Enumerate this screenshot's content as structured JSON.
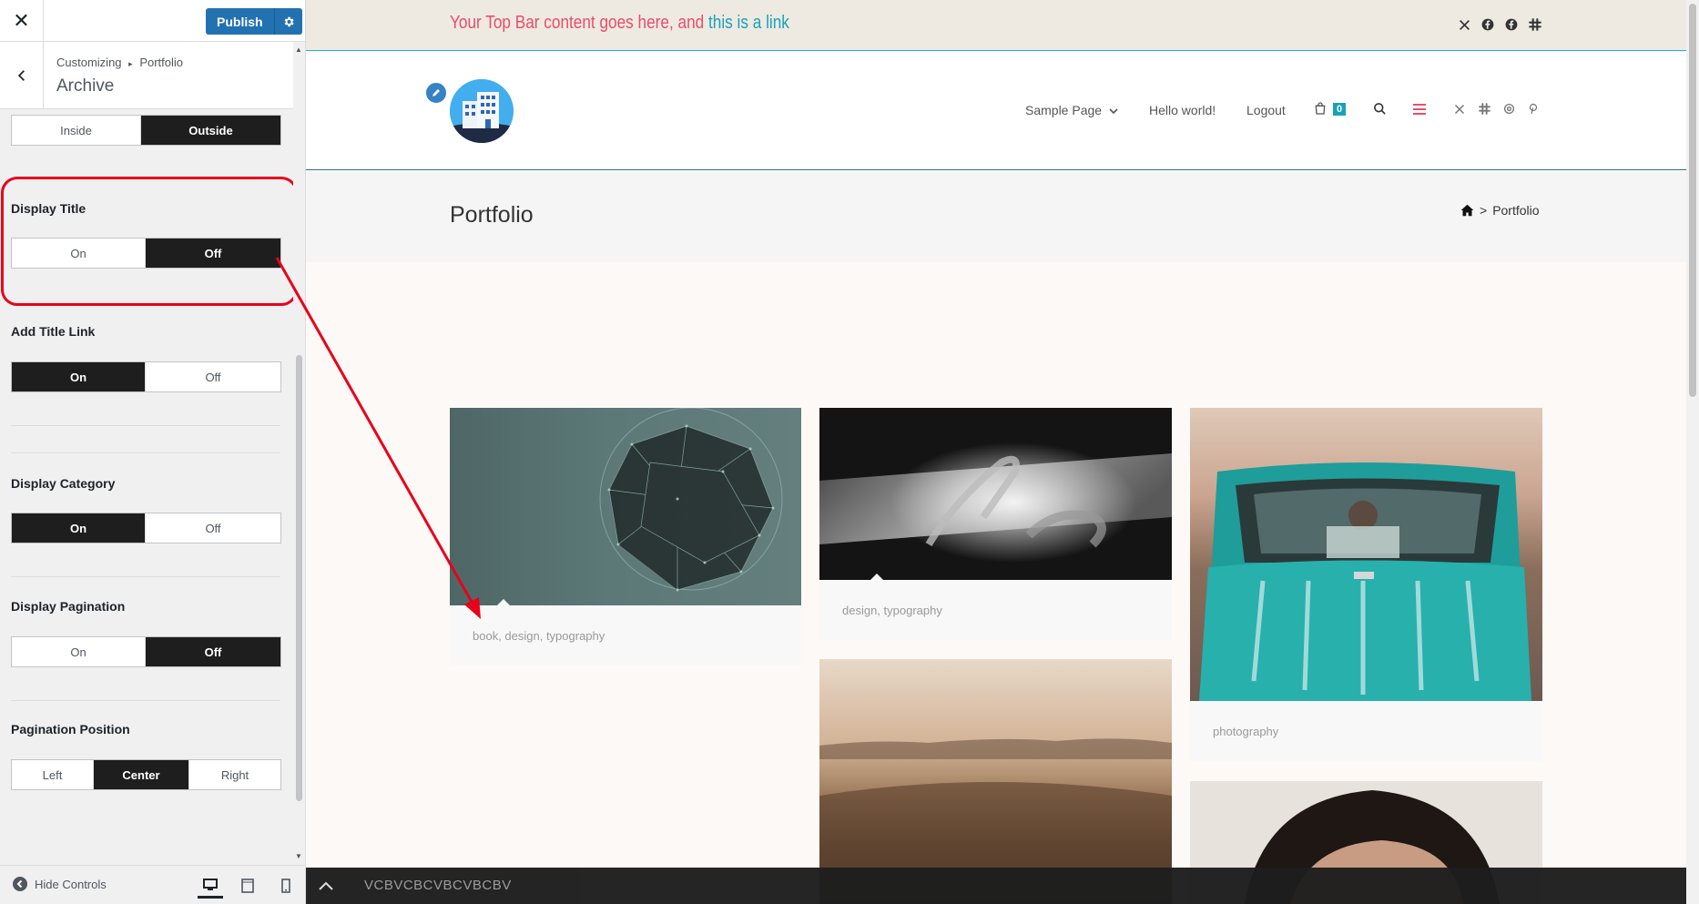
{
  "customizer": {
    "close_label": "✕",
    "publish_label": "Publish",
    "breadcrumb_root": "Customizing",
    "breadcrumb_sep": "▸",
    "breadcrumb_parent": "Portfolio",
    "section_title": "Archive",
    "controls": {
      "position_options": [
        "Inside",
        "Outside"
      ],
      "position_selected": "Outside",
      "display_title": {
        "label": "Display Title",
        "options": [
          "On",
          "Off"
        ],
        "selected": "Off"
      },
      "add_title_link": {
        "label": "Add Title Link",
        "options": [
          "On",
          "Off"
        ],
        "selected": "On"
      },
      "display_category": {
        "label": "Display Category",
        "options": [
          "On",
          "Off"
        ],
        "selected": "On"
      },
      "display_pagination": {
        "label": "Display Pagination",
        "options": [
          "On",
          "Off"
        ],
        "selected": "Off"
      },
      "pagination_position": {
        "label": "Pagination Position",
        "options": [
          "Left",
          "Center",
          "Right"
        ],
        "selected": "Center"
      }
    },
    "footer": {
      "hide_controls": "Hide Controls",
      "devices": [
        "desktop-icon",
        "tablet-icon",
        "mobile-icon"
      ]
    },
    "highlight_color": "#e8001b",
    "accent_color": "#2271b1"
  },
  "site": {
    "topbar": {
      "text": "Your Top Bar content goes here, and ",
      "link": "this is a link",
      "text_color": "#e84e6a",
      "link_color": "#17a2b8"
    },
    "topbar_social": [
      "x-icon",
      "facebook-icon",
      "facebook-icon",
      "slack-icon"
    ],
    "nav": {
      "items": [
        "Sample Page",
        "Hello world!",
        "Logout"
      ],
      "cart_count": "0",
      "header_social": [
        "x-icon",
        "slack-icon",
        "threads-icon",
        "pinterest-icon"
      ]
    },
    "page_title": "Portfolio",
    "breadcrumb_current": "Portfolio",
    "breadcrumb_sep": ">",
    "portfolio": [
      {
        "categories": "book, design, typography"
      },
      {
        "categories": "design, typography"
      },
      {
        "categories": "photography"
      }
    ],
    "footer_bar_text": "VCBVCBCVBCVBCBV"
  }
}
